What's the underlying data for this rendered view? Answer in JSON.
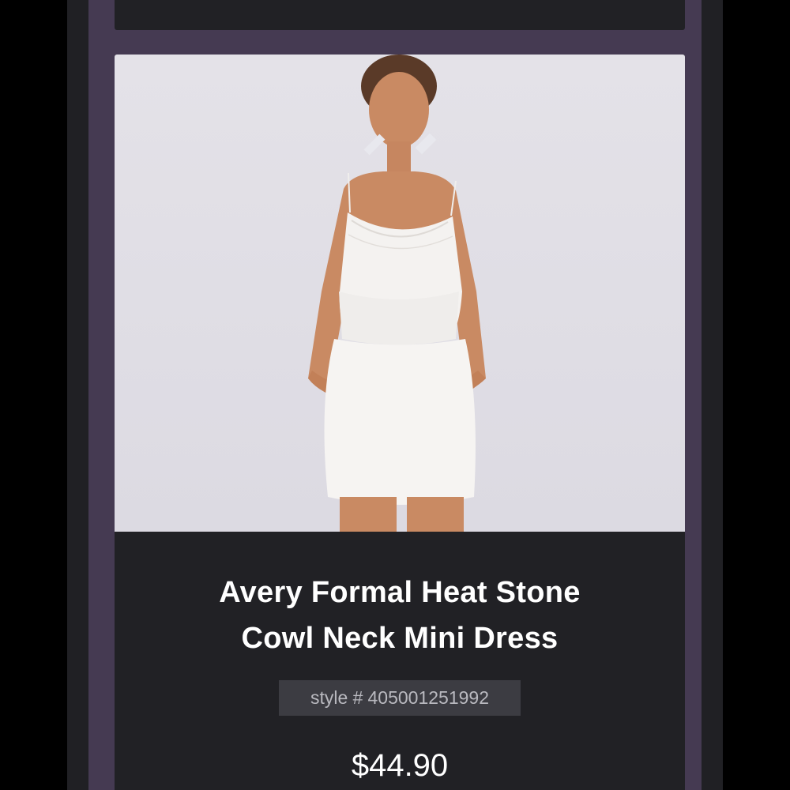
{
  "product": {
    "image_alt": "Model wearing white cowl neck mini dress",
    "title_line1": "Avery Formal Heat Stone",
    "title_line2": "Cowl Neck Mini Dress",
    "style_prefix": "style #",
    "style_number": "405001251992",
    "price": "$44.90"
  },
  "colors": {
    "frame": "#202024",
    "accent_band": "#453a52",
    "card": "#212125",
    "badge": "#3c3c42",
    "text": "#ffffff"
  }
}
